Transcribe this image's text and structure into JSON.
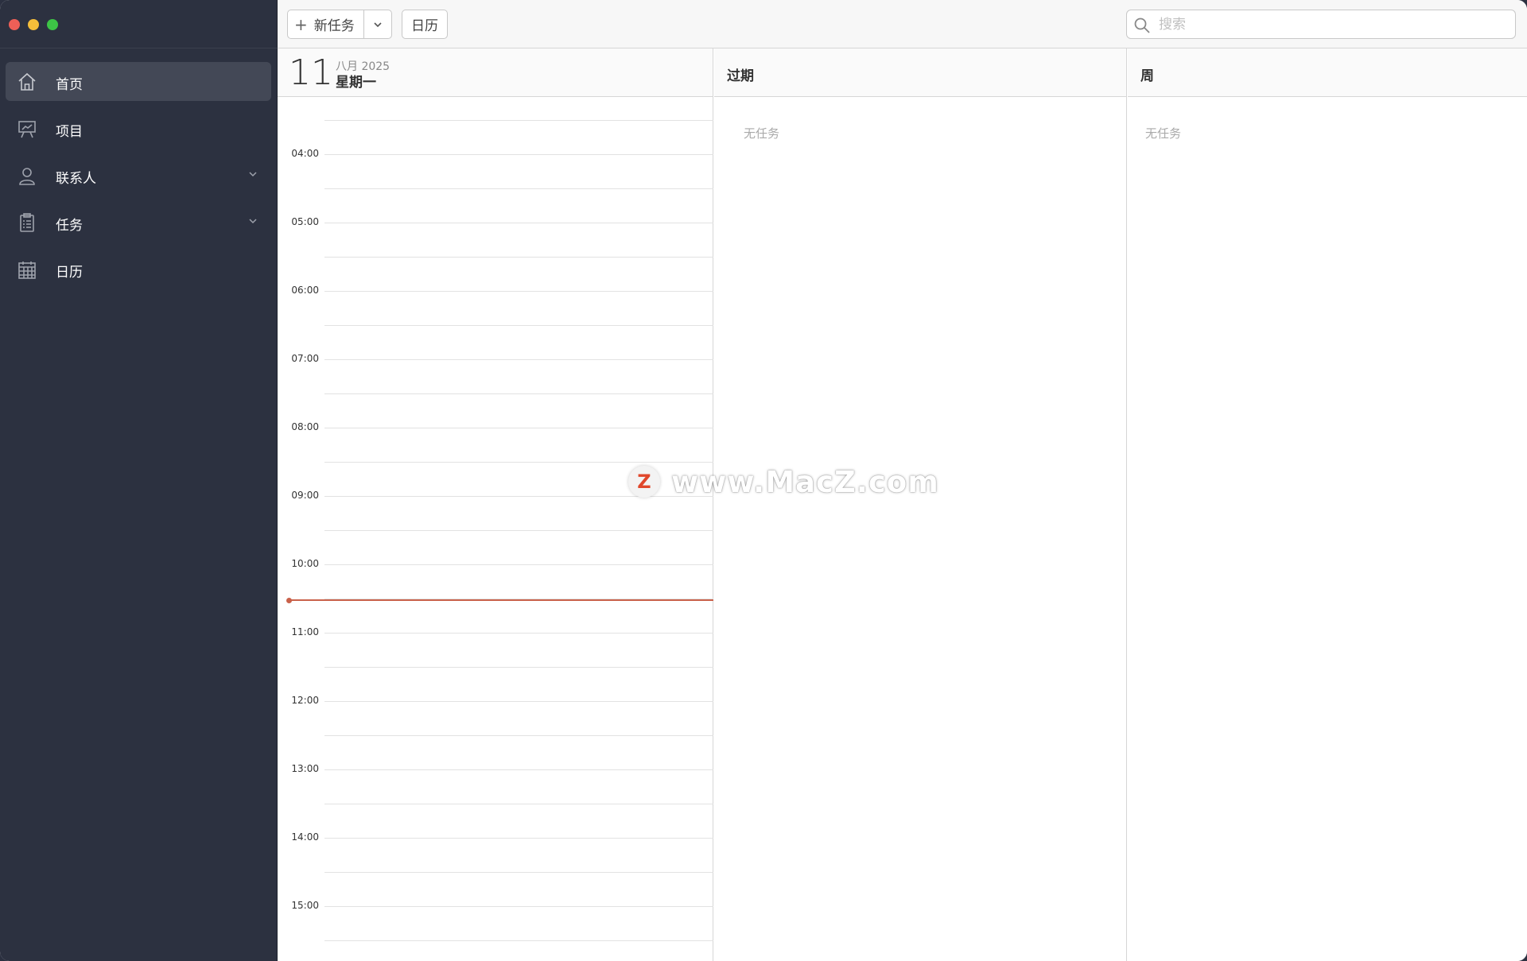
{
  "sidebar": {
    "items": [
      {
        "label": "首页",
        "icon": "home-icon",
        "active": true
      },
      {
        "label": "项目",
        "icon": "presentation-icon"
      },
      {
        "label": "联系人",
        "icon": "person-icon",
        "expandable": true
      },
      {
        "label": "任务",
        "icon": "clipboard-icon",
        "expandable": true
      },
      {
        "label": "日历",
        "icon": "calendar-icon"
      }
    ]
  },
  "toolbar": {
    "new_task_label": "新任务",
    "calendar_label": "日历",
    "search_placeholder": "搜索"
  },
  "day": {
    "number": "11",
    "month_year": "八月 2025",
    "weekday": "星期一",
    "hours": [
      "04:00",
      "05:00",
      "06:00",
      "07:00",
      "08:00",
      "09:00",
      "10:00",
      "11:00",
      "12:00",
      "13:00",
      "14:00",
      "15:00"
    ],
    "now_indicator_color": "#c9614a"
  },
  "overdue": {
    "title": "过期",
    "empty_text": "无任务"
  },
  "week": {
    "title": "周",
    "empty_text": "无任务"
  },
  "watermark": {
    "logo": "Z",
    "text": "www.MacZ.com"
  }
}
